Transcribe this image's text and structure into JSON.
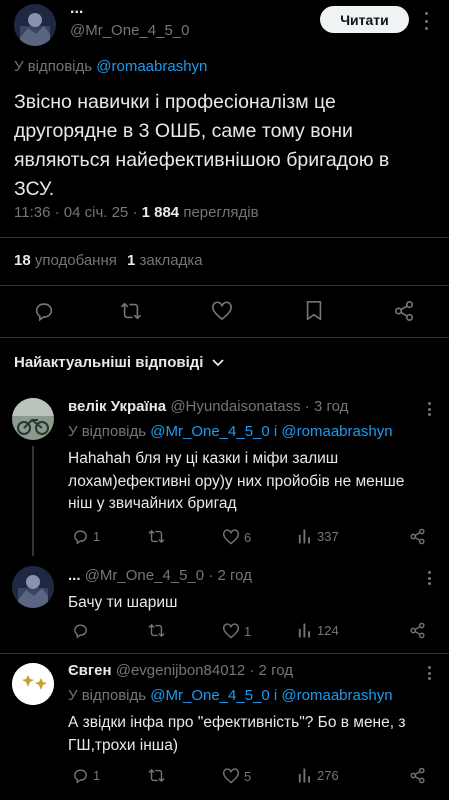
{
  "main_tweet": {
    "display_name": "...",
    "handle": "@Mr_One_4_5_0",
    "follow_label": "Читати",
    "reply_to_prefix": "У відповідь",
    "reply_to_handle": "@romaabrashyn",
    "text": "Звісно навички і професіоналізм це другорядне в 3 ОШБ, саме тому вони являються найефективнішою бригадою в ЗСУ.",
    "time": "11:36 · 04 січ. 25 · ",
    "views_count": "1 884",
    "views_label": " переглядів",
    "likes_count": "18",
    "likes_label": " уподобання",
    "bookmarks_count": "1",
    "bookmarks_label": " закладка"
  },
  "replies_header": "Найактуальніші відповіді",
  "replies": [
    {
      "display_name": "велік Україна",
      "handle": "@Hyundaisonatass",
      "time": "· 3 год",
      "reply_prefix": "У відповідь",
      "reply_handle_1": "@Mr_One_4_5_0",
      "reply_and": "і",
      "reply_handle_2": "@romaabrashyn",
      "text": "Hahahah бля ну ці казки і міфи залиш лохам)ефективні ору)у них пройобів не менше ніш у звичайних бригад",
      "replies": "1",
      "retweets": "",
      "likes": "6",
      "views": "337"
    },
    {
      "display_name": "...",
      "handle": "@Mr_One_4_5_0",
      "time": "· 2 год",
      "text": "Бачу ти шариш",
      "replies": "",
      "retweets": "",
      "likes": "1",
      "views": "124"
    },
    {
      "display_name": "Євген",
      "handle": "@evgenijbon84012",
      "time": "· 2 год",
      "reply_prefix": "У відповідь",
      "reply_handle_1": "@Mr_One_4_5_0",
      "reply_and": "і",
      "reply_handle_2": "@romaabrashyn",
      "text": "А звідки інфа про \"ефективність\"? Бо в мене, з ГШ,трохи інша)",
      "replies": "1",
      "retweets": "",
      "likes": "5",
      "views": "276"
    }
  ],
  "colors": {
    "background": "#000000",
    "text": "#e7e9ea",
    "secondary": "#71767b",
    "link": "#1d9bf0",
    "divider": "#2f3336"
  },
  "icons": [
    "reply-icon",
    "retweet-icon",
    "like-icon",
    "views-icon",
    "bookmark-icon",
    "share-icon",
    "chevron-down-icon",
    "more-icon"
  ]
}
